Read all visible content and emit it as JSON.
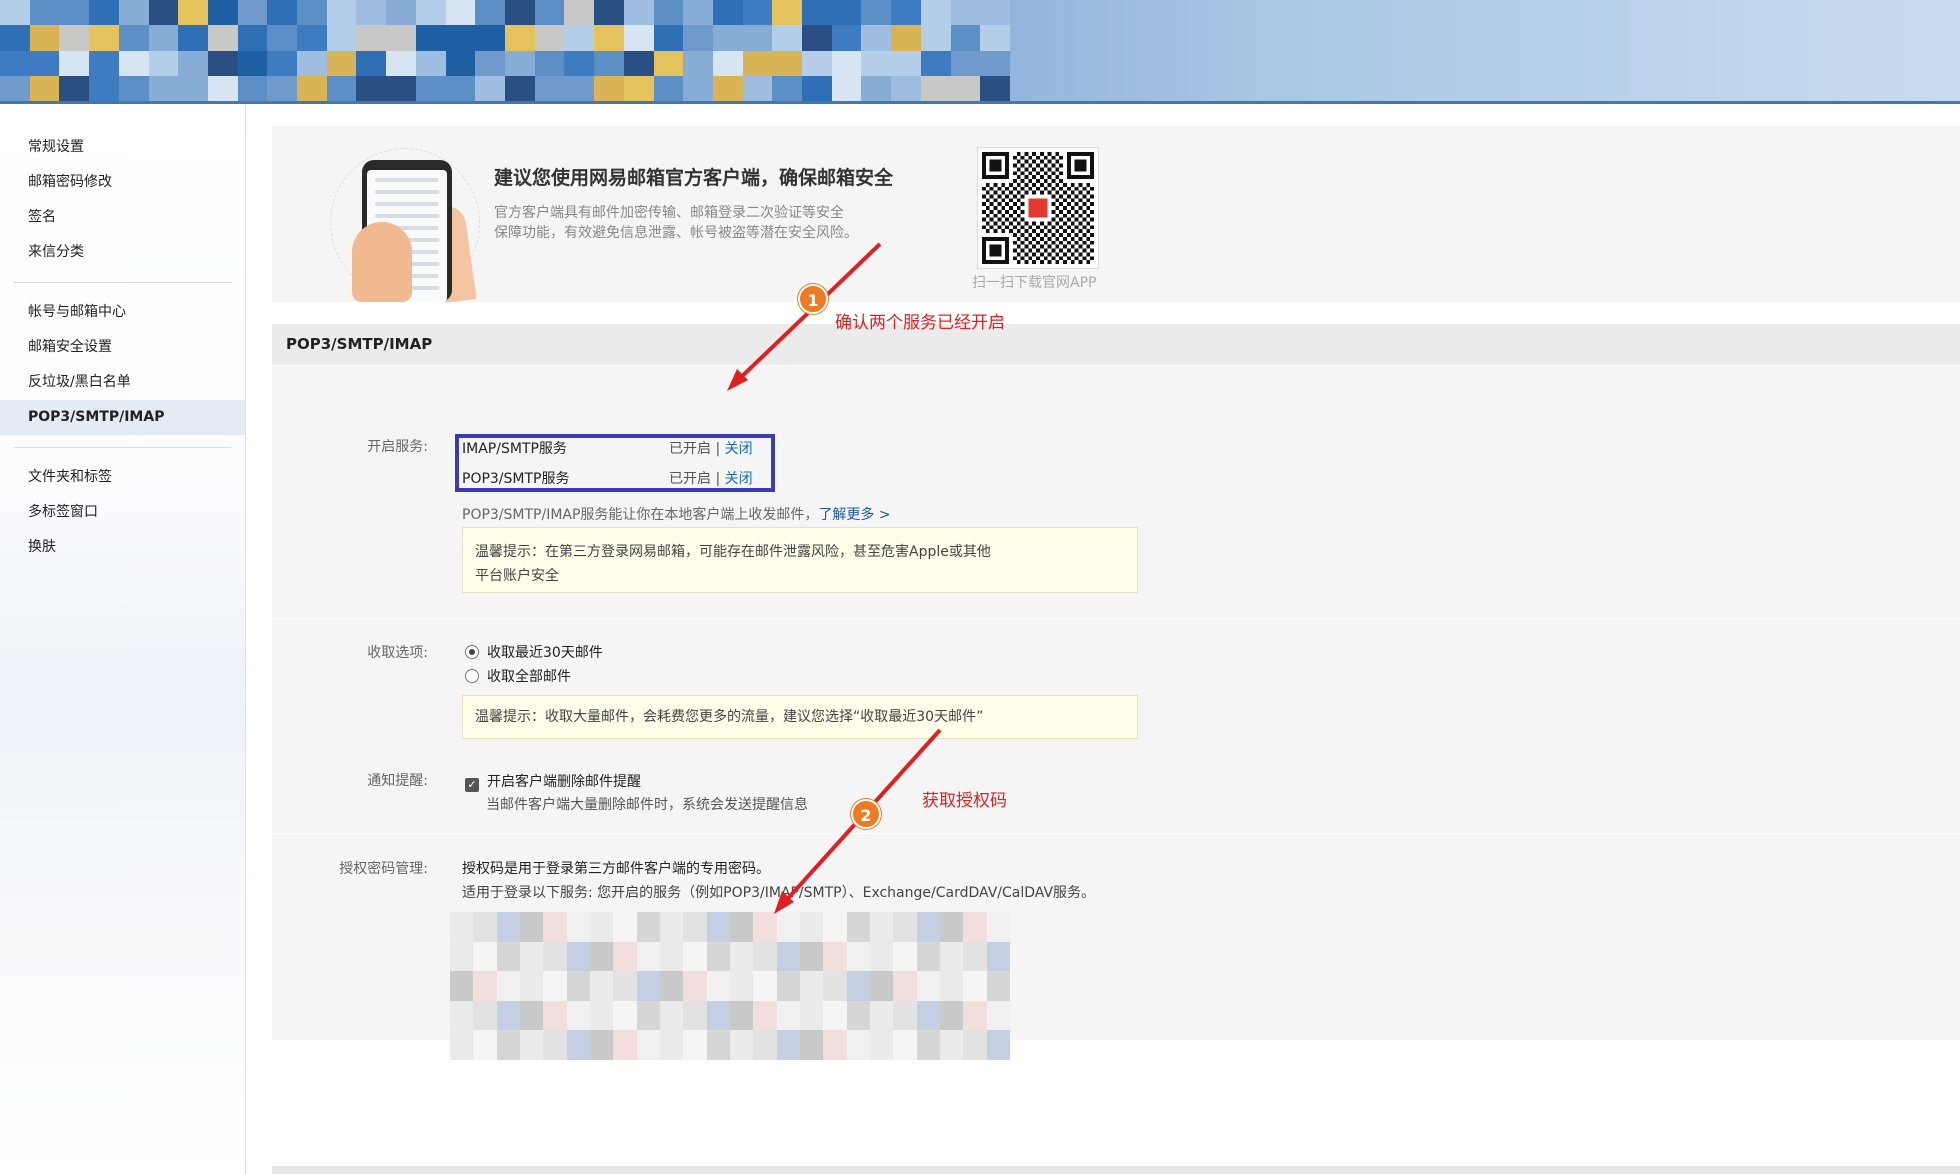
{
  "sidebar": {
    "groups": [
      [
        "常规设置",
        "邮箱密码修改",
        "签名",
        "来信分类"
      ],
      [
        "帐号与邮箱中心",
        "邮箱安全设置",
        "反垃圾/黑白名单",
        "POP3/SMTP/IMAP"
      ],
      [
        "文件夹和标签",
        "多标签窗口",
        "换肤"
      ]
    ],
    "active": "POP3/SMTP/IMAP"
  },
  "banner": {
    "title": "建议您使用网易邮箱官方客户端，确保邮箱安全",
    "desc_line1": "官方客户端具有邮件加密传输、邮箱登录二次验证等安全",
    "desc_line2": "保障功能，有效避免信息泄露、帐号被盗等潜在安全风险。",
    "qr_caption": "扫一扫下载官网APP",
    "qr_logo": "mail-logo-icon"
  },
  "section_title": "POP3/SMTP/IMAP",
  "services": {
    "label": "开启服务:",
    "items": [
      {
        "name": "IMAP/SMTP服务",
        "status": "已开启",
        "sep": "|",
        "action": "关闭"
      },
      {
        "name": "POP3/SMTP服务",
        "status": "已开启",
        "sep": "|",
        "action": "关闭"
      }
    ],
    "desc": "POP3/SMTP/IMAP服务能让你在本地客户端上收发邮件，",
    "learn_more": "了解更多 >",
    "tip_line1": "温馨提示：在第三方登录网易邮箱，可能存在邮件泄露风险，甚至危害Apple或其他",
    "tip_line2": "平台账户安全"
  },
  "receive": {
    "label": "收取选项:",
    "options": [
      "收取最近30天邮件",
      "收取全部邮件"
    ],
    "selected": "收取最近30天邮件",
    "tip": "温馨提示：收取大量邮件，会耗费您更多的流量，建议您选择“收取最近30天邮件”"
  },
  "notify": {
    "label": "通知提醒:",
    "checkbox": "开启客户端删除邮件提醒",
    "checked": true,
    "note": "当邮件客户端大量删除邮件时，系统会发送提醒信息"
  },
  "auth": {
    "label": "授权密码管理:",
    "line1": "授权码是用于登录第三方邮件客户端的专用密码。",
    "line2": "适用于登录以下服务: 您开启的服务（例如POP3/IMAP/SMTP）、Exchange/CardDAV/CalDAV服务。"
  },
  "annotations": {
    "badge1": "1",
    "text1": "确认两个服务已经开启",
    "badge2": "2",
    "text2": "获取授权码",
    "color": "#e02020"
  }
}
